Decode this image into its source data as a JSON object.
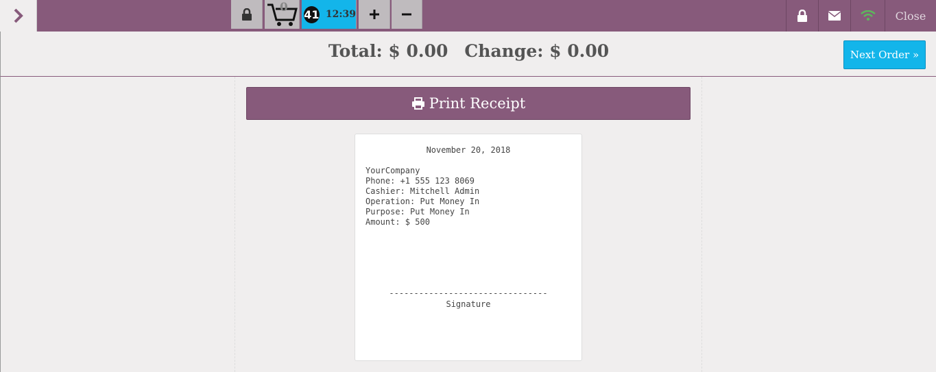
{
  "topbar": {
    "cart_count": "0",
    "order_number": "41",
    "order_time": "12:39",
    "close_label": "Close"
  },
  "header": {
    "total_label": "Total: $ 0.00",
    "change_label": "Change: $ 0.00",
    "next_order_label": "Next Order »"
  },
  "print": {
    "label": "Print Receipt"
  },
  "receipt": {
    "date": "November 20, 2018",
    "lines": [
      "YourCompany",
      "Phone: +1 555 123 8069",
      "Cashier: Mitchell Admin",
      "Operation: Put Money In",
      "Purpose: Put Money In",
      "Amount: $ 500"
    ],
    "signature_line": "--------------------------------",
    "signature_label": "Signature"
  },
  "colors": {
    "brand": "#875a7b",
    "accent": "#13b5ea",
    "wifi": "#5cb85c"
  },
  "icons": [
    "chevron-right-icon",
    "lock-icon",
    "cart-icon",
    "plus-icon",
    "minus-icon",
    "envelope-icon",
    "wifi-icon",
    "printer-icon"
  ]
}
